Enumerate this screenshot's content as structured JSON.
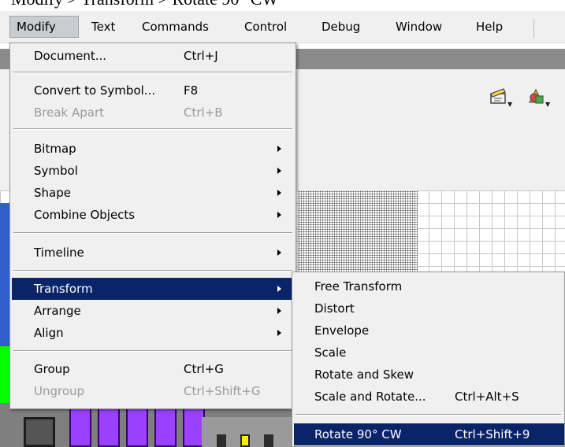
{
  "caption": "Modify > Transform > Rotate 90° CW",
  "menubar": {
    "items": [
      {
        "label": "Modify"
      },
      {
        "label": "Text"
      },
      {
        "label": "Commands"
      },
      {
        "label": "Control"
      },
      {
        "label": "Debug"
      },
      {
        "label": "Window"
      },
      {
        "label": "Help"
      }
    ]
  },
  "modify_menu": {
    "items": [
      {
        "label": "Document...",
        "shortcut": "Ctrl+J"
      },
      {
        "label": "Convert to Symbol...",
        "shortcut": "F8"
      },
      {
        "label": "Break Apart",
        "shortcut": "Ctrl+B"
      },
      {
        "label": "Bitmap"
      },
      {
        "label": "Symbol"
      },
      {
        "label": "Shape"
      },
      {
        "label": "Combine Objects"
      },
      {
        "label": "Timeline"
      },
      {
        "label": "Transform"
      },
      {
        "label": "Arrange"
      },
      {
        "label": "Align"
      },
      {
        "label": "Group",
        "shortcut": "Ctrl+G"
      },
      {
        "label": "Ungroup",
        "shortcut": "Ctrl+Shift+G"
      }
    ]
  },
  "transform_menu": {
    "items": [
      {
        "label": "Free Transform"
      },
      {
        "label": "Distort"
      },
      {
        "label": "Envelope"
      },
      {
        "label": "Scale"
      },
      {
        "label": "Rotate and Skew"
      },
      {
        "label": "Scale and Rotate...",
        "shortcut": "Ctrl+Alt+S"
      },
      {
        "label": "Rotate 90° CW",
        "shortcut": "Ctrl+Shift+9"
      }
    ]
  },
  "icons": {
    "scene": "clapperboard-icon",
    "symbol": "shapes-icon"
  },
  "colors": {
    "highlight": "#0a246a",
    "menu_bg": "#f0f0f0"
  }
}
